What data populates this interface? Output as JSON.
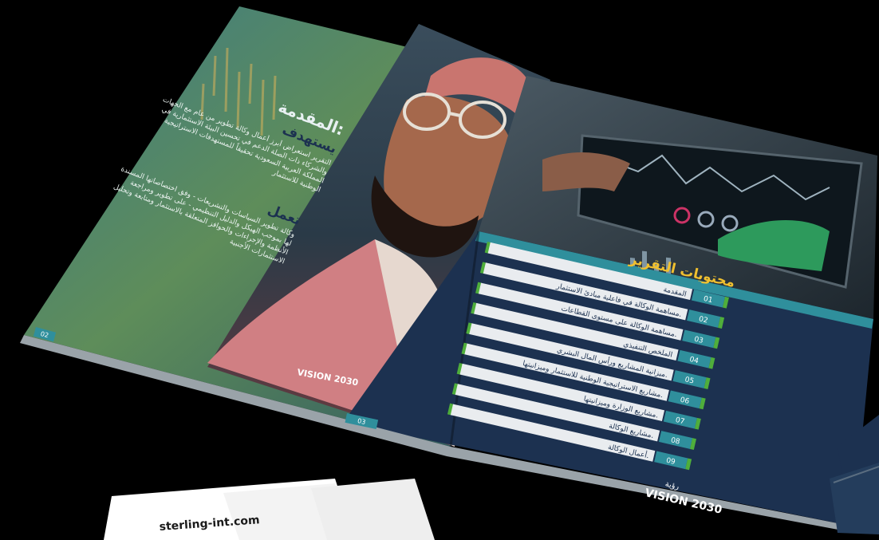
{
  "left_page": {
    "heading_intro": "المقدمة:",
    "heading_sub": "يستهدف",
    "intro_text": "التقرير استعراض أبرز أعمال وكالة تطوير من عام مع الجهات والشركاء ذات الصلة الدعم في تحسين البيئة الاستثمارية في المملكة العربية السعودية تحقيقاً للمستهدفات الاستراتيجية الوطنية للاستثمار",
    "heading_work": "تعمل",
    "work_text": "وكالة تطوير السياسات والتشريعات - وفق اختصاصاتها المسندة لها بموجب الهيكل والدليل التنظيمي - على تطوير ومراجعة الأنظمة والإجراءات والحوافز المتعلقة بالاستثمار ومتابعة وتحليل الاستثمارات الأجنبية",
    "page_number": "02"
  },
  "photo_page": {
    "page_number": "03",
    "vision_logo_text": "VISION 2030"
  },
  "toc": {
    "title": "محتويات التقرير",
    "items": [
      {
        "number": "01",
        "label": "المقدمة"
      },
      {
        "number": "02",
        "label": "مساهمة الوكالة في فاعلية مبادئ الاستثمار."
      },
      {
        "number": "03",
        "label": "مساهمة الوكالة على مستوى القطاعات."
      },
      {
        "number": "04",
        "label": "الملخص التنفيذي"
      },
      {
        "number": "05",
        "label": "ميزانية المشاريع ورأس المال البشري."
      },
      {
        "number": "06",
        "label": "مشاريع الاستراتيجية الوطنية للاستثمار وميزانيتها."
      },
      {
        "number": "07",
        "label": "مشاريع الوزارة وميزانيتها."
      },
      {
        "number": "08",
        "label": "مشاريع الوكالة."
      },
      {
        "number": "09",
        "label": "أعمال الوكالة."
      }
    ],
    "vision_logo_text": "VISION 2030",
    "vision_logo_arabic": "رؤية"
  },
  "card": {
    "website": "sterling-int.com"
  },
  "colors": {
    "navy": "#1c3150",
    "teal": "#2f8f9c",
    "green": "#4fae3b",
    "light_bar": "#e9ecef"
  }
}
